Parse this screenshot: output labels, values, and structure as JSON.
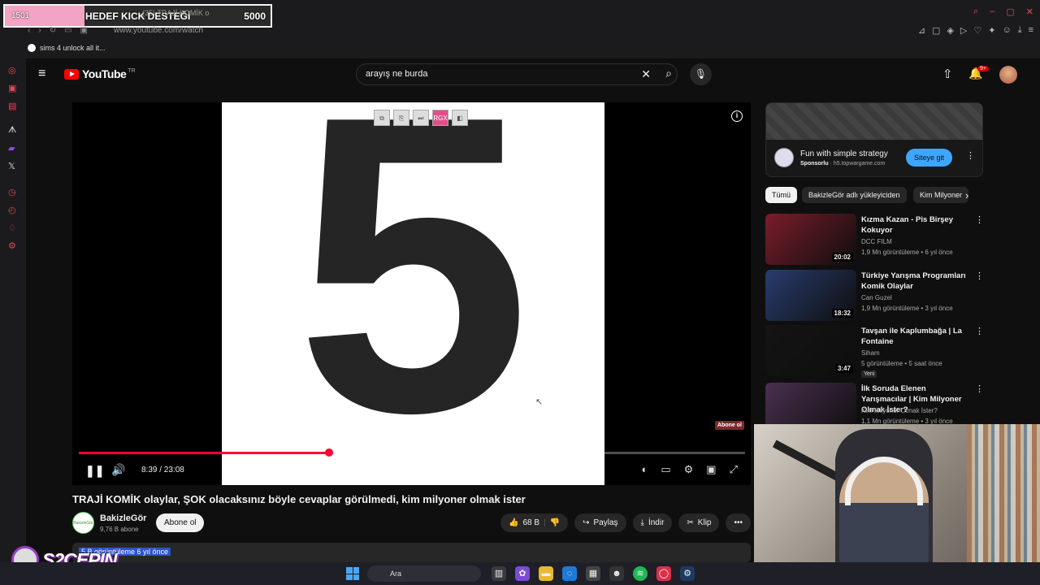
{
  "stream_goal": {
    "current": "1501",
    "label": "HEDEF KICK DESTEĞİ",
    "target": "5000",
    "progress": 0.3
  },
  "browser": {
    "tab_title": "(35) TRAJİ KOMİK o",
    "url": "www.youtube.com/watch",
    "bookmark": "sims 4 unlock all it..."
  },
  "youtube": {
    "logo_text": "YouTube",
    "region": "TR",
    "search_value": "arayış ne burda",
    "notification_count": "9+"
  },
  "player": {
    "big_number": "5",
    "time": "8:39 / 23:08",
    "progress": 0.375,
    "mini_tools": [
      "⧉",
      "⎘",
      "⏭",
      "RGX",
      "◧"
    ],
    "abone_badge": "Abone ol"
  },
  "video": {
    "title": "TRAJİ KOMİK olaylar, ŞOK olacaksınız böyle cevaplar görülmedi, kim milyoner olmak ister",
    "channel": "BakizleGör",
    "subscribers": "9,76 B abone",
    "subscribe_label": "Abone ol",
    "likes": "68 B",
    "share_label": "Paylaş",
    "download_label": "İndir",
    "clip_label": "Klip",
    "views_line": "5 B görüntüleme  6 yıl önce"
  },
  "ad": {
    "title": "Fun with simple strategy",
    "sponsored": "Sponsorlu",
    "domain": "h5.topwargame.com",
    "cta": "Siteye git"
  },
  "chips": [
    {
      "label": "Tümü"
    },
    {
      "label": "BakizleGör adlı yükleyiciden"
    },
    {
      "label": "Kim Milyoner"
    }
  ],
  "recommendations": [
    {
      "title": "Kızma Kazan - Pis Birşey Kokuyor",
      "channel": "DCC FILM",
      "meta": "1,9 Mn görüntüleme • 6 yıl önce",
      "duration": "20:02",
      "thumb_color": "#7a1d2a",
      "new": ""
    },
    {
      "title": "Türkiye Yarışma Programları Komik Olaylar",
      "channel": "Can Guzel",
      "meta": "1,9 Mn görüntüleme • 3 yıl önce",
      "duration": "18:32",
      "thumb_color": "#2a3c6e",
      "new": ""
    },
    {
      "title": "Tavşan ile Kaplumbağa | La Fontaine",
      "channel": "Siham",
      "meta": "5 görüntüleme • 5 saat önce",
      "duration": "3:47",
      "thumb_color": "#141414",
      "new": "Yeni"
    },
    {
      "title": "İlk Soruda Elenen Yarışmacılar | Kim Milyoner Olmak İster?",
      "channel": "Kim Milyoner Olmak İster?",
      "meta": "1,1 Mn görüntüleme • 3 yıl önce",
      "duration": "",
      "thumb_color": "#4a3050",
      "new": ""
    }
  ],
  "streamer_logo": "S2CEPIN",
  "taskbar": {
    "search_label": "Ara"
  }
}
